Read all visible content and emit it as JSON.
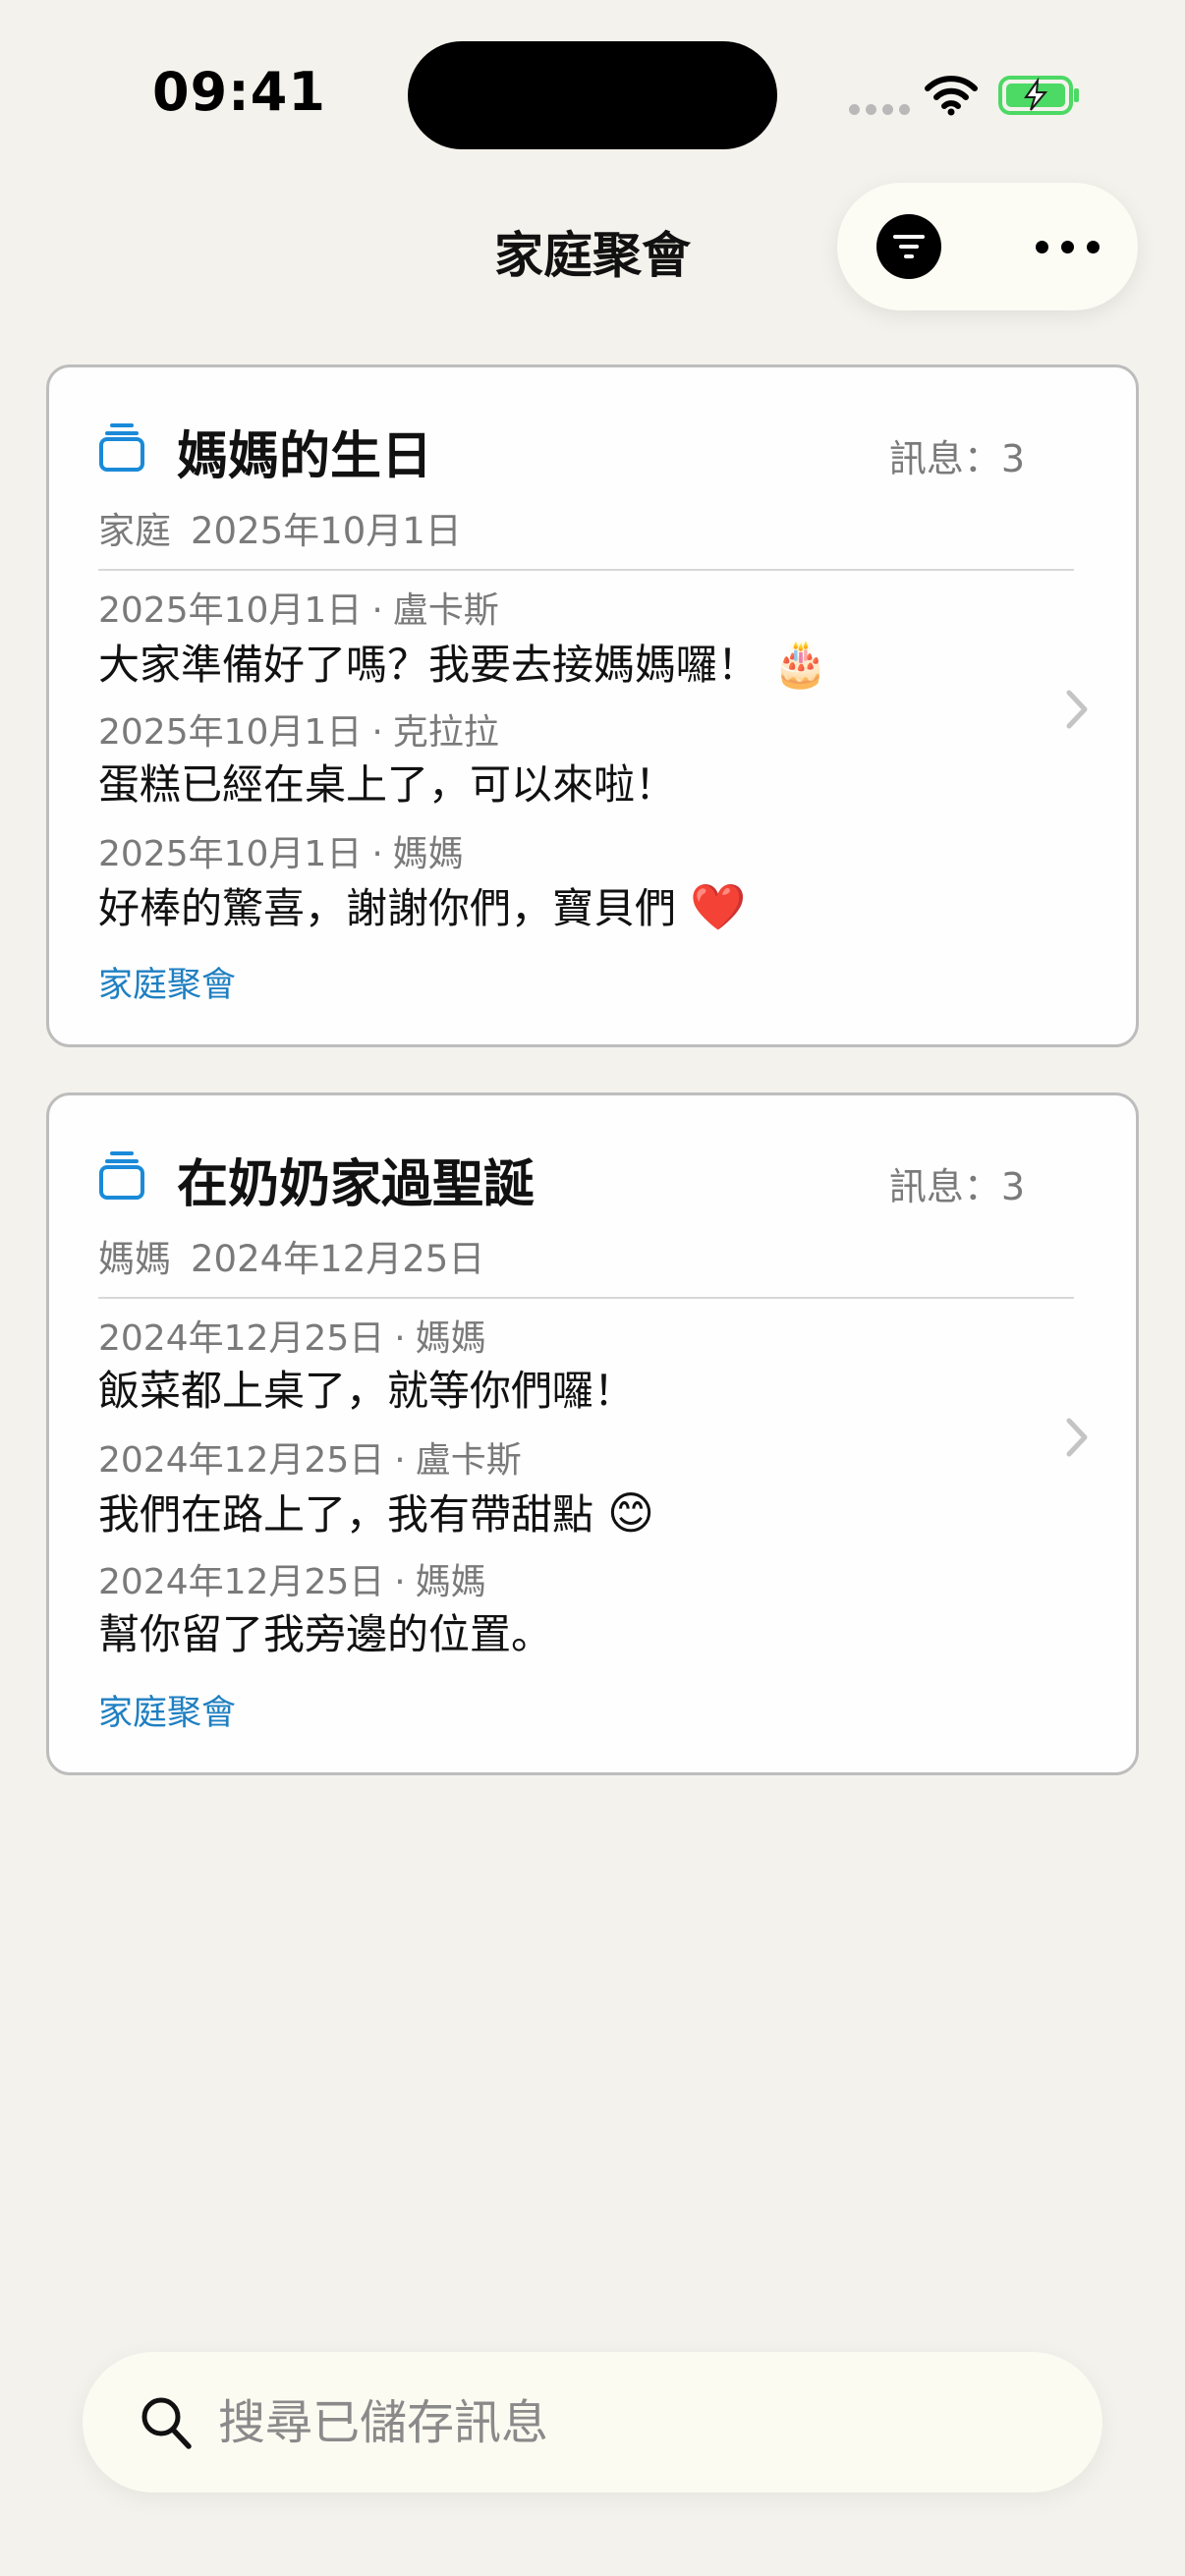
{
  "status_bar": {
    "time": "09:41",
    "icons": [
      "signal-icon",
      "wifi-icon",
      "battery-charging-icon"
    ],
    "battery_color": "#4cd964"
  },
  "header": {
    "title": "家庭聚會",
    "actions": [
      "filter-icon",
      "more-icon"
    ]
  },
  "accent_color": "#1f7fc2",
  "groups": [
    {
      "title": "媽媽的生日",
      "count_label": "訊息：3",
      "owner": "家庭",
      "date": "2025年10月1日",
      "tag": "家庭聚會",
      "messages": [
        {
          "date": "2025年10月1日",
          "sender": "盧卡斯",
          "text": "大家準備好了嗎？我要去接媽媽囉！",
          "emoji": "🎂"
        },
        {
          "date": "2025年10月1日",
          "sender": "克拉拉",
          "text": "蛋糕已經在桌上了，可以來啦！",
          "emoji": ""
        },
        {
          "date": "2025年10月1日",
          "sender": "媽媽",
          "text": "好棒的驚喜，謝謝你們，寶貝們",
          "emoji": "❤️"
        }
      ]
    },
    {
      "title": "在奶奶家過聖誕",
      "count_label": "訊息：3",
      "owner": "媽媽",
      "date": "2024年12月25日",
      "tag": "家庭聚會",
      "messages": [
        {
          "date": "2024年12月25日",
          "sender": "媽媽",
          "text": "飯菜都上桌了，就等你們囉！",
          "emoji": ""
        },
        {
          "date": "2024年12月25日",
          "sender": "盧卡斯",
          "text": "我們在路上了，我有帶甜點",
          "emoji": "😊"
        },
        {
          "date": "2024年12月25日",
          "sender": "媽媽",
          "text": "幫你留了我旁邊的位置。",
          "emoji": ""
        }
      ]
    }
  ],
  "search": {
    "placeholder": "搜尋已儲存訊息",
    "value": ""
  },
  "separator": "·"
}
